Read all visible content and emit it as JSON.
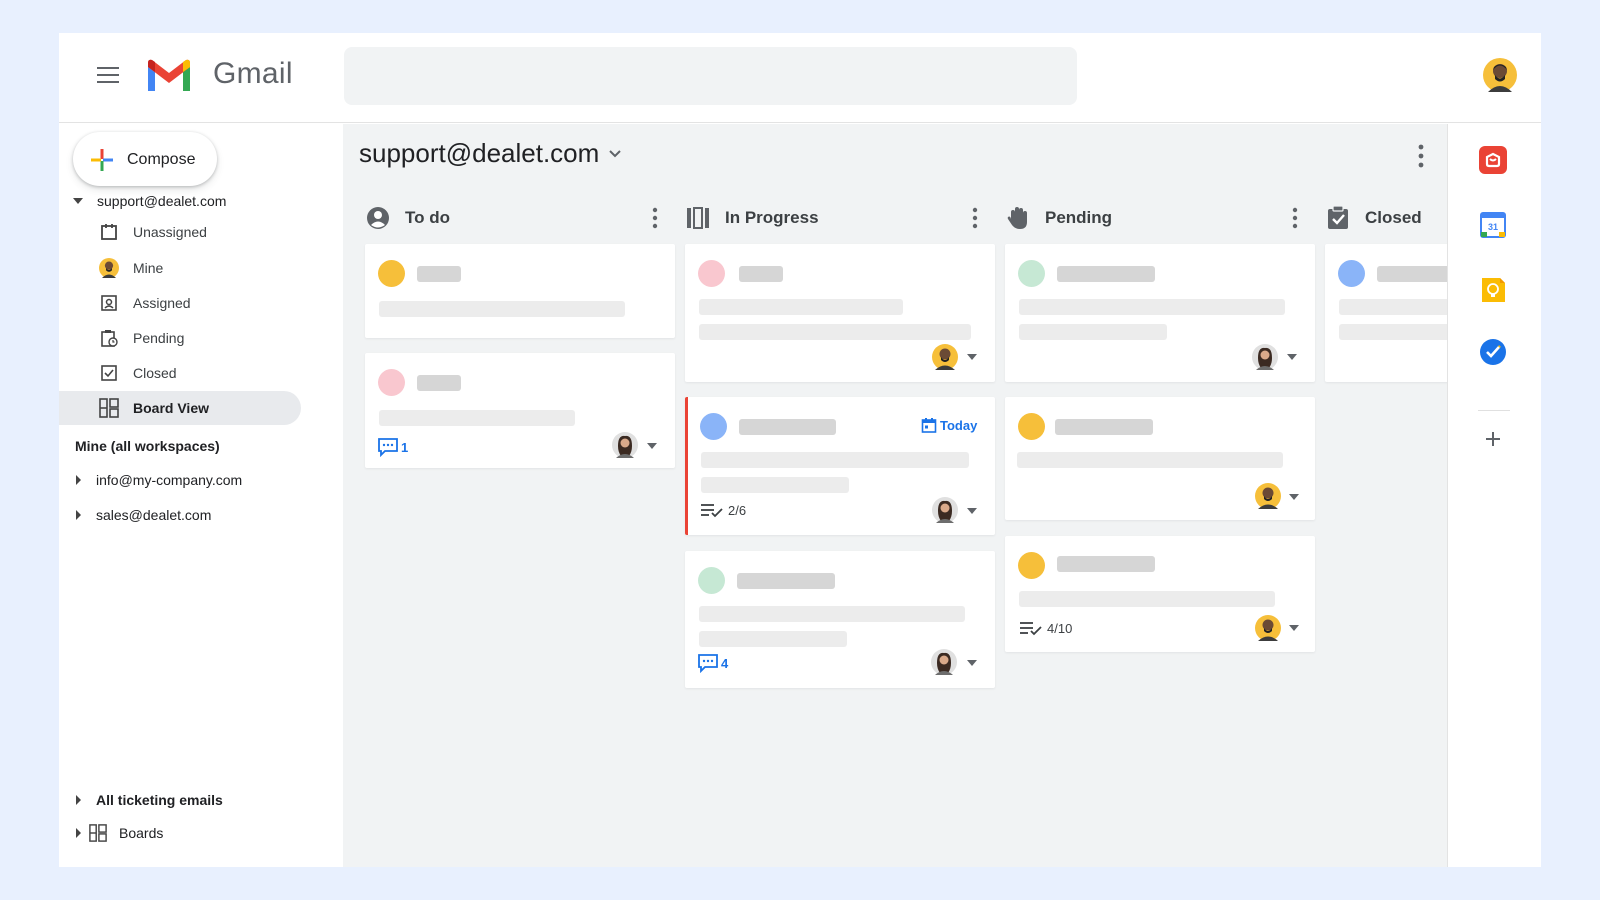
{
  "app": {
    "name": "Gmail",
    "search": {
      "placeholder": ""
    }
  },
  "sidebar": {
    "compose_label": "Compose",
    "account": "support@dealet.com",
    "items": [
      {
        "label": "Unassigned",
        "icon": "inbox-tray-icon"
      },
      {
        "label": "Mine",
        "icon": "avatar"
      },
      {
        "label": "Assigned",
        "icon": "assigned-badge-icon"
      },
      {
        "label": "Pending",
        "icon": "clipboard-clock-icon"
      },
      {
        "label": "Closed",
        "icon": "checkbox-icon"
      },
      {
        "label": "Board View",
        "icon": "board-grid-icon",
        "active": true
      }
    ],
    "section_mine_all": "Mine (all workspaces)",
    "other_accounts": [
      {
        "label": "info@my-company.com"
      },
      {
        "label": "sales@dealet.com"
      }
    ],
    "bottom": [
      {
        "label": "All ticketing emails"
      },
      {
        "label": "Boards"
      }
    ]
  },
  "board": {
    "title": "support@dealet.com",
    "columns": [
      {
        "name": "To do",
        "icon": "account-circle-icon"
      },
      {
        "name": "In Progress",
        "icon": "columns-icon"
      },
      {
        "name": "Pending",
        "icon": "hand-icon"
      },
      {
        "name": "Closed",
        "icon": "checkbox-checked-icon"
      }
    ],
    "cards": {
      "todo_2_comments": "1",
      "inprog_2_due": "Today",
      "inprog_2_checklist": "2/6",
      "inprog_3_comments": "4",
      "pending_3_checklist": "4/10"
    }
  },
  "colors": {
    "accent_blue": "#1a73e8",
    "flag_red": "#ea4335",
    "dot_yellow": "#f6bf3a",
    "dot_pink": "#f9c7cf",
    "dot_blue": "#8ab4f8",
    "dot_green": "#c6e8d4"
  },
  "rail": {
    "apps": [
      "dealet-icon",
      "calendar-icon",
      "keep-icon",
      "tasks-icon",
      "add-icon"
    ]
  }
}
